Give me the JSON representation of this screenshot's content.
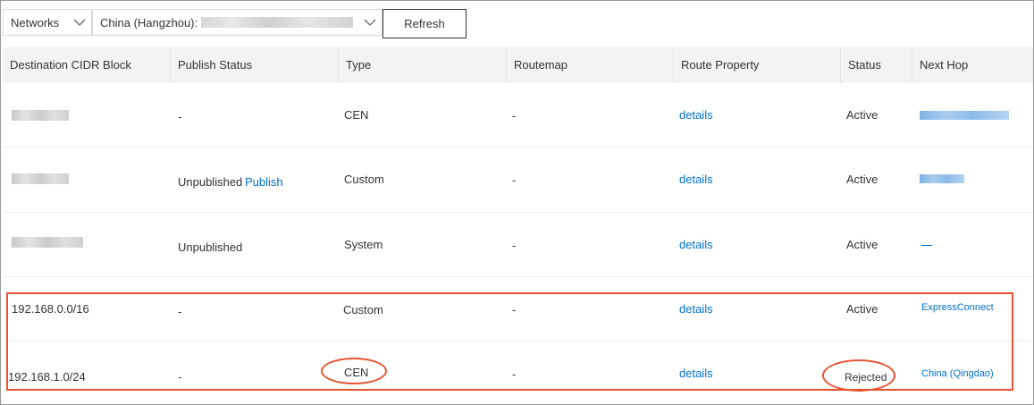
{
  "toolbar": {
    "networks_value": "Networks",
    "region_value": "China (Hangzhou):",
    "refresh_label": "Refresh"
  },
  "table": {
    "columns": [
      "Destination CIDR Block",
      "Publish Status",
      "Type",
      "Routemap",
      "Route Property",
      "Status",
      "Next Hop"
    ],
    "rows": [
      {
        "cidr": "",
        "publish_status": "-",
        "publish_action": "",
        "type": "CEN",
        "routemap": "-",
        "route_property": "details",
        "status": "Active",
        "next_hop": ""
      },
      {
        "cidr": "",
        "publish_status": "Unpublished",
        "publish_action": "Publish",
        "type": "Custom",
        "routemap": "-",
        "route_property": "details",
        "status": "Active",
        "next_hop": ""
      },
      {
        "cidr": "",
        "publish_status": "Unpublished",
        "publish_action": "",
        "type": "System",
        "routemap": "-",
        "route_property": "details",
        "status": "Active",
        "next_hop": ""
      },
      {
        "cidr": "192.168.0.0/16",
        "publish_status": "-",
        "publish_action": "",
        "type": "Custom",
        "routemap": "-",
        "route_property": "details",
        "status": "Active",
        "next_hop": "ExpressConnect"
      },
      {
        "cidr": "192.168.1.0/24",
        "publish_status": "-",
        "publish_action": "",
        "type": "CEN",
        "routemap": "-",
        "route_property": "details",
        "status": "Rejected",
        "next_hop": "China (Qingdao)"
      }
    ]
  },
  "colors": {
    "link": "#0070cc",
    "highlight": "#e8532f",
    "header_bg": "#f2f3f5"
  }
}
